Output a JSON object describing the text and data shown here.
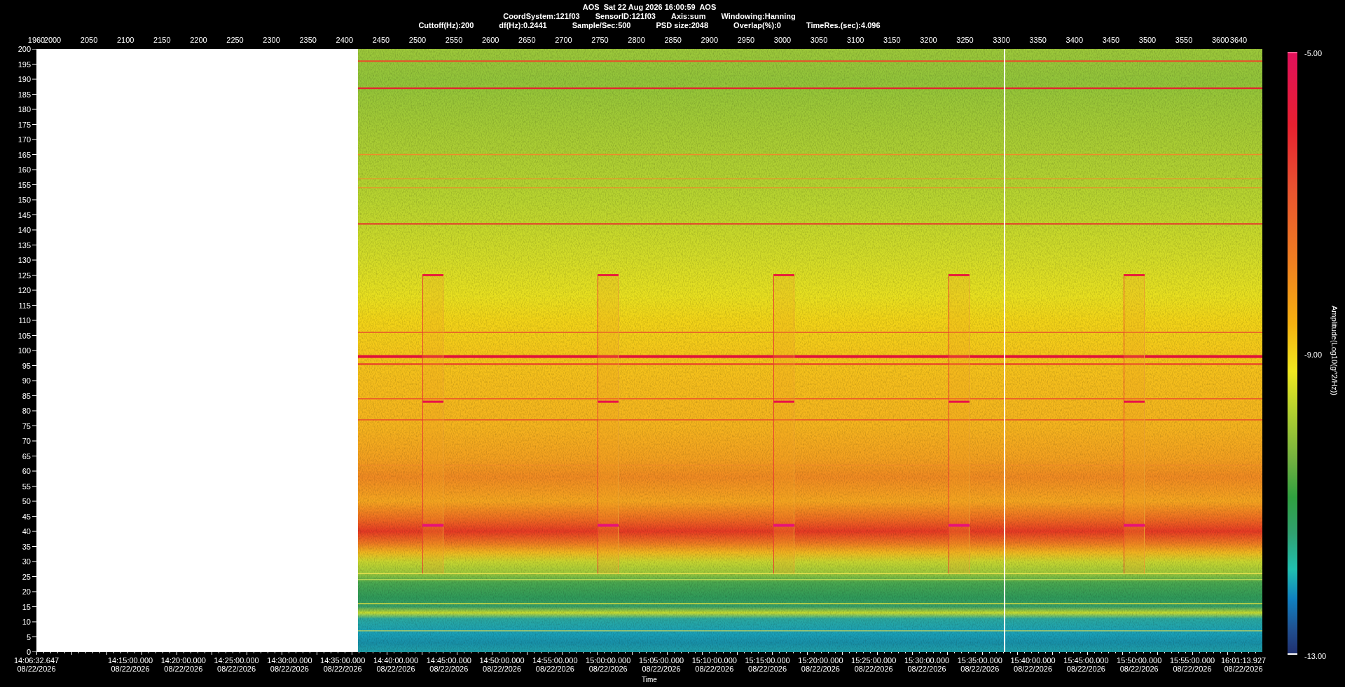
{
  "header": {
    "title": "AOS  Sat 22 Aug 2026 16:00:59  AOS",
    "info_line_1": [
      "CoordSystem:121f03",
      "SensorID:121f03",
      "Axis:sum",
      "Windowing:Hanning"
    ],
    "info_line_2": [
      "Cuttoff(Hz):200",
      "df(Hz):0.2441",
      "Sample/Sec:500",
      "PSD size:2048",
      "Overlap(%):0",
      "TimeRes.(sec):4.096"
    ]
  },
  "top_axis": {
    "ticks": [
      "1960",
      "2000",
      "2050",
      "2100",
      "2150",
      "2200",
      "2250",
      "2300",
      "2350",
      "2400",
      "2450",
      "2500",
      "2550",
      "2600",
      "2650",
      "2700",
      "2750",
      "2800",
      "2850",
      "2900",
      "2950",
      "3000",
      "3050",
      "3100",
      "3150",
      "3200",
      "3250",
      "3300",
      "3350",
      "3400",
      "3450",
      "3500",
      "3550",
      "3600",
      "3640"
    ]
  },
  "y_axis": {
    "ticks": [
      "200",
      "195",
      "190",
      "185",
      "180",
      "175",
      "170",
      "165",
      "160",
      "155",
      "150",
      "145",
      "140",
      "135",
      "130",
      "125",
      "120",
      "115",
      "110",
      "105",
      "100",
      "95",
      "90",
      "85",
      "80",
      "75",
      "70",
      "65",
      "60",
      "55",
      "50",
      "45",
      "40",
      "35",
      "30",
      "25",
      "20",
      "15",
      "10",
      "5",
      "0"
    ]
  },
  "x_axis": {
    "label": "Time",
    "ticks": [
      {
        "time": "14:06:32.647",
        "date": "08/22/2026"
      },
      {
        "time": "14:15:00.000",
        "date": "08/22/2026"
      },
      {
        "time": "14:20:00.000",
        "date": "08/22/2026"
      },
      {
        "time": "14:25:00.000",
        "date": "08/22/2026"
      },
      {
        "time": "14:30:00.000",
        "date": "08/22/2026"
      },
      {
        "time": "14:35:00.000",
        "date": "08/22/2026"
      },
      {
        "time": "14:40:00.000",
        "date": "08/22/2026"
      },
      {
        "time": "14:45:00.000",
        "date": "08/22/2026"
      },
      {
        "time": "14:50:00.000",
        "date": "08/22/2026"
      },
      {
        "time": "14:55:00.000",
        "date": "08/22/2026"
      },
      {
        "time": "15:00:00.000",
        "date": "08/22/2026"
      },
      {
        "time": "15:05:00.000",
        "date": "08/22/2026"
      },
      {
        "time": "15:10:00.000",
        "date": "08/22/2026"
      },
      {
        "time": "15:15:00.000",
        "date": "08/22/2026"
      },
      {
        "time": "15:20:00.000",
        "date": "08/22/2026"
      },
      {
        "time": "15:25:00.000",
        "date": "08/22/2026"
      },
      {
        "time": "15:30:00.000",
        "date": "08/22/2026"
      },
      {
        "time": "15:35:00.000",
        "date": "08/22/2026"
      },
      {
        "time": "15:40:00.000",
        "date": "08/22/2026"
      },
      {
        "time": "15:45:00.000",
        "date": "08/22/2026"
      },
      {
        "time": "15:50:00.000",
        "date": "08/22/2026"
      },
      {
        "time": "15:55:00.000",
        "date": "08/22/2026"
      },
      {
        "time": "16:01:13.927",
        "date": "08/22/2026"
      }
    ]
  },
  "colorbar": {
    "label": "Amplitude(Log10(g^2/Hz))",
    "ticks": [
      "-5.00",
      "-9.00",
      "-13.00"
    ]
  }
}
